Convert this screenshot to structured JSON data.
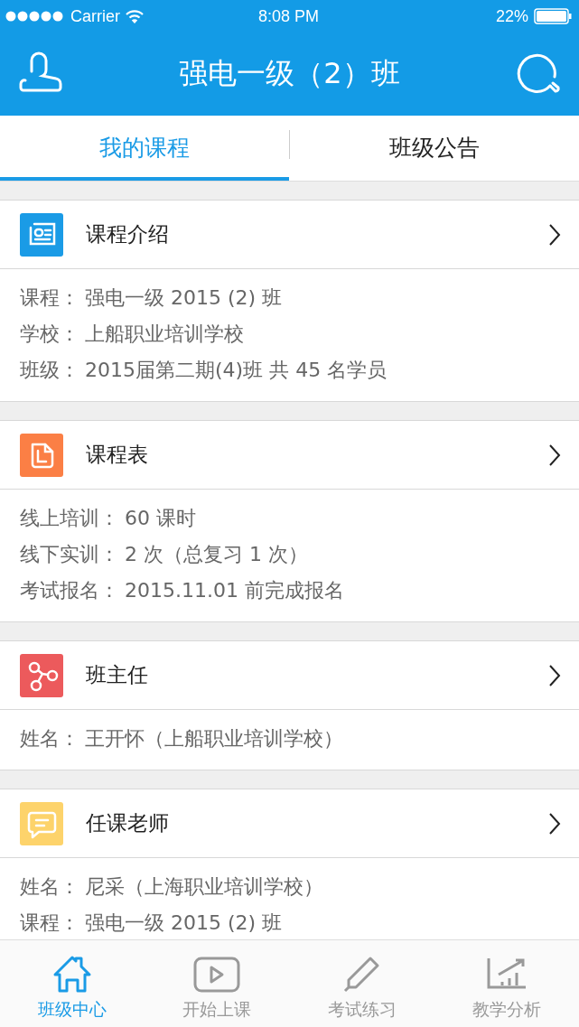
{
  "status_bar": {
    "carrier": "Carrier",
    "time": "8:08 PM",
    "battery": "22%"
  },
  "header": {
    "title": "强电一级（2）班"
  },
  "tabs": [
    {
      "label": "我的课程",
      "selected": true
    },
    {
      "label": "班级公告",
      "selected": false
    }
  ],
  "sections": [
    {
      "kind": "intro",
      "title": "课程介绍",
      "lines": [
        {
          "label": "课程：",
          "value": "强电一级 2015 (2) 班"
        },
        {
          "label": "学校：",
          "value": "上船职业培训学校"
        },
        {
          "label": "班级：",
          "value": "2015届第二期(4)班 共 45 名学员"
        }
      ]
    },
    {
      "kind": "schedule",
      "title": "课程表",
      "lines": [
        {
          "label": "线上培训：",
          "value": "60 课时"
        },
        {
          "label": "线下实训：",
          "value": "2 次（总复习 1 次）"
        },
        {
          "label": "考试报名：",
          "value": "2015.11.01 前完成报名"
        }
      ]
    },
    {
      "kind": "head_teacher",
      "title": "班主任",
      "lines": [
        {
          "label": "姓名：",
          "value": "王开怀（上船职业培训学校）"
        }
      ]
    },
    {
      "kind": "teacher",
      "title": "任课老师",
      "lines": [
        {
          "label": "姓名：",
          "value": "尼采（上海职业培训学校）"
        },
        {
          "label": "课程：",
          "value": "强电一级 2015 (2) 班"
        }
      ]
    }
  ],
  "bottom_nav": [
    {
      "kind": "home",
      "label": "班级中心",
      "selected": true
    },
    {
      "kind": "play",
      "label": "开始上课",
      "selected": false
    },
    {
      "kind": "pencil",
      "label": "考试练习",
      "selected": false
    },
    {
      "kind": "chart",
      "label": "教学分析",
      "selected": false
    }
  ]
}
